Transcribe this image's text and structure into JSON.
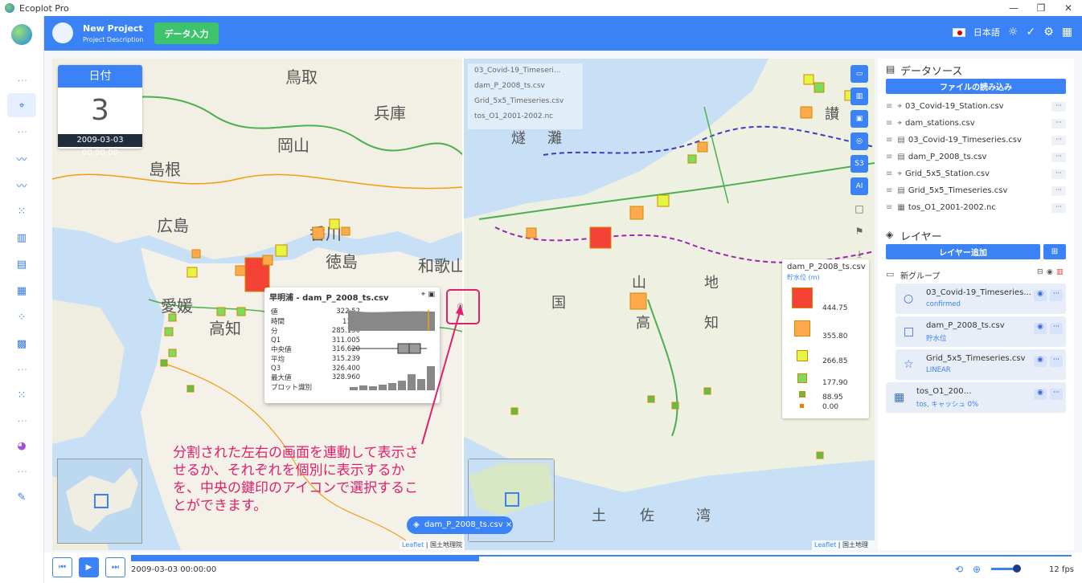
{
  "window": {
    "title": "Ecoplot Pro",
    "controls": [
      "—",
      "❐",
      "✕"
    ]
  },
  "header": {
    "project_name": "New Project",
    "project_desc": "Project Description",
    "data_input": "データ入力",
    "language": "日本語"
  },
  "date_card": {
    "label": "日付",
    "day": "3",
    "timestamp": "2009-03-03 00:00:00"
  },
  "popup": {
    "title": "早明浦 - dam_P_2008_ts.csv",
    "rows": [
      {
        "k": "値",
        "v": "322.52"
      },
      {
        "k": "時間",
        "v": "11 月"
      },
      {
        "k": "分",
        "v": "285.190"
      },
      {
        "k": "Q1",
        "v": "311.005"
      },
      {
        "k": "中央値",
        "v": "316.620"
      },
      {
        "k": "平均",
        "v": "315.239"
      },
      {
        "k": "Q3",
        "v": "326.400"
      },
      {
        "k": "最大値",
        "v": "328.960"
      },
      {
        "k": "プロット識別",
        "v": ""
      }
    ]
  },
  "map_layers_overlay": [
    "03_Covid-19_Timeseri...",
    "dam_P_2008_ts.csv",
    "Grid_5x5_Timeseries.csv",
    "tos_O1_2001-2002.nc"
  ],
  "legend": {
    "title": "dam_P_2008_ts.csv",
    "unit": "貯水位 (m)",
    "entries": [
      {
        "value": "444.75",
        "color": "#f44336"
      },
      {
        "value": "355.80",
        "color": "#ffa94d"
      },
      {
        "value": "266.85",
        "color": "#e6f542"
      },
      {
        "value": "177.90",
        "color": "#7ddc5a"
      },
      {
        "value": "88.95",
        "color": "#5fbf4a"
      },
      {
        "value": "0.00",
        "color": "#f57c00"
      }
    ]
  },
  "map_tools": [
    "S3",
    "AI"
  ],
  "annotation": "分割された左右の画面を連動して表示させるか、それぞれを個別に表示するかを、中央の鍵印のアイコンで選択することができます。",
  "chip": {
    "label": "dam_P_2008_ts.csv ×"
  },
  "attribution": {
    "leaflet": "Leaflet",
    "source": "国土地理院"
  },
  "sidebar": {
    "data_source_title": "データソース",
    "load_file": "ファイルの読み込み",
    "sources": [
      {
        "icon": "⌖",
        "name": "03_Covid-19_Station.csv"
      },
      {
        "icon": "⌖",
        "name": "dam_stations.csv"
      },
      {
        "icon": "▤",
        "name": "03_Covid-19_Timeseries.csv"
      },
      {
        "icon": "▤",
        "name": "dam_P_2008_ts.csv"
      },
      {
        "icon": "⌖",
        "name": "Grid_5x5_Station.csv"
      },
      {
        "icon": "▤",
        "name": "Grid_5x5_Timeseries.csv"
      },
      {
        "icon": "▦",
        "name": "tos_O1_2001-2002.nc"
      }
    ],
    "layer_title": "レイヤー",
    "add_layer": "レイヤー追加",
    "group_name": "新グループ",
    "layers": [
      {
        "icon": "○",
        "name": "03_Covid-19_Timeseries...",
        "sub": "confirmed"
      },
      {
        "icon": "□",
        "name": "dam_P_2008_ts.csv",
        "sub": "貯水位"
      },
      {
        "icon": "☆",
        "name": "Grid_5x5_Timeseries.csv",
        "sub": "LINEAR"
      },
      {
        "icon": "▦",
        "name": "tos_O1_200…",
        "sub": "tos, キャッシュ 0%"
      }
    ]
  },
  "playback": {
    "time": "2009-03-03 00:00:00",
    "fps": "12 fps",
    "progress": 0.37
  },
  "colors": {
    "accent": "#3b82f6",
    "green": "#3cc36b",
    "annotation": "#e0206e"
  }
}
